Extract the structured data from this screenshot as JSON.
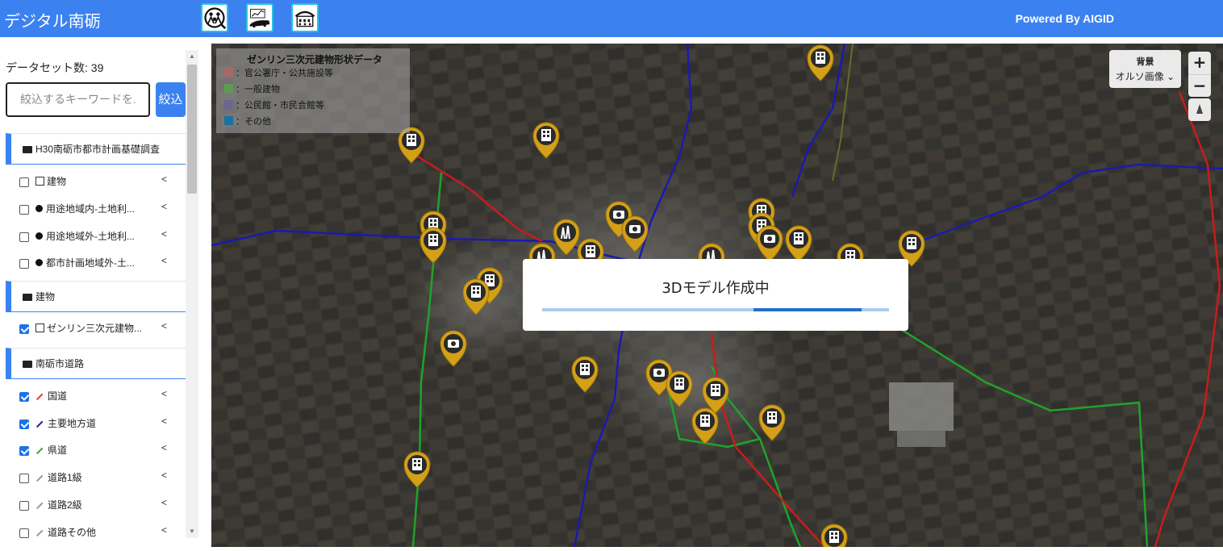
{
  "header": {
    "title": "デジタル南砺",
    "powered_by": "Powered By AIGID",
    "tool_icons": [
      "community-people-search-icon",
      "chart-train-icon",
      "building-people-icon"
    ]
  },
  "sidebar": {
    "dataset_count": "データセット数: 39",
    "search": {
      "placeholder": "絞込するキーワードを..",
      "value": "絞込するキーワードを.",
      "button": "絞込"
    },
    "groups": [
      {
        "label": "H30南砺市都市計画基礎調査",
        "items": [
          {
            "label": "建物",
            "checked": false,
            "icon": "building-outline-icon"
          },
          {
            "label": "用途地域内-土地利...",
            "checked": false,
            "icon": "polygon-icon"
          },
          {
            "label": "用途地域外-土地利...",
            "checked": false,
            "icon": "polygon-icon"
          },
          {
            "label": "都市計画地域外-土...",
            "checked": false,
            "icon": "polygon-icon"
          }
        ]
      },
      {
        "label": "建物",
        "items": [
          {
            "label": "ゼンリン三次元建物...",
            "checked": true,
            "icon": "building-outline-icon"
          }
        ]
      },
      {
        "label": "南砺市道路",
        "items": [
          {
            "label": "国道",
            "checked": true,
            "icon": "line-icon",
            "color": "#e53935"
          },
          {
            "label": "主要地方道",
            "checked": true,
            "icon": "line-icon",
            "color": "#1a237e"
          },
          {
            "label": "県道",
            "checked": true,
            "icon": "line-icon",
            "color": "#43a047"
          },
          {
            "label": "道路1級",
            "checked": false,
            "icon": "line-icon",
            "color": "#999999"
          },
          {
            "label": "道路2級",
            "checked": false,
            "icon": "line-icon",
            "color": "#999999"
          },
          {
            "label": "道路その他",
            "checked": false,
            "icon": "line-icon",
            "color": "#999999"
          }
        ]
      }
    ]
  },
  "map": {
    "legend": {
      "title": "ゼンリン三次元建物形状データ",
      "entries": [
        {
          "label": "：官公署庁・公共施設等",
          "color": "#a86868"
        },
        {
          "label": "：一般建物",
          "color": "#5c9b52"
        },
        {
          "label": "：公民館・市民会館等",
          "color": "#6a6590"
        },
        {
          "label": "：その他",
          "color": "#1c6fa3"
        }
      ]
    },
    "background": {
      "title": "背景",
      "selected": "オルソ画像"
    },
    "zoom_in": "+",
    "zoom_out": "−"
  },
  "modal": {
    "message": "3Dモデル作成中",
    "progress_start": 0.61,
    "progress_end": 0.92
  },
  "colors": {
    "accent": "#3b82f0",
    "national_road": "#e53935",
    "prefectural_main": "#1a237e",
    "prefectural": "#43a047",
    "pin": "#d4a017"
  }
}
